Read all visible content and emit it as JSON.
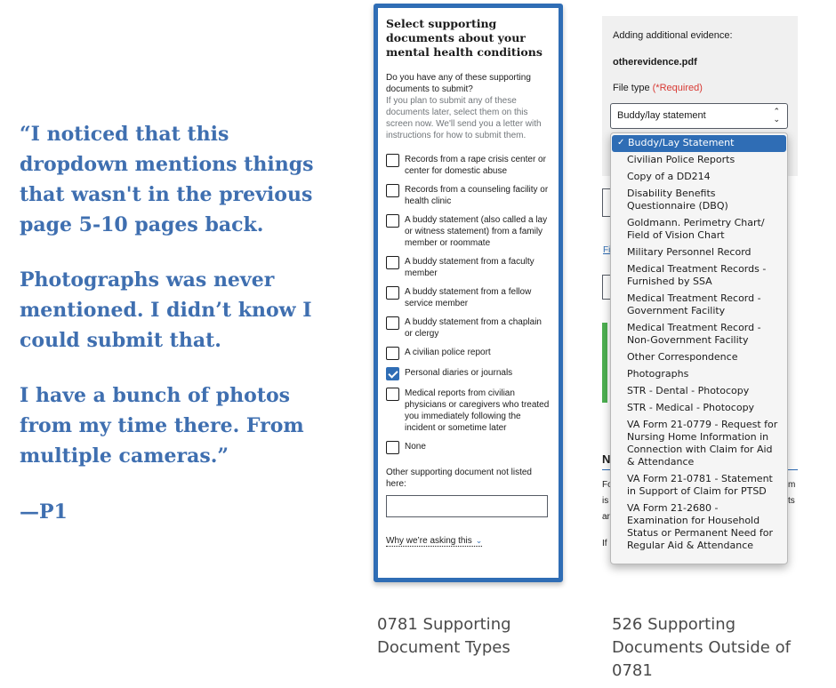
{
  "quote": {
    "paragraphs": [
      "“I noticed that this dropdown mentions things that wasn't in the previous page 5-10 pages back.",
      "Photographs was never mentioned. I didn’t know I could submit that.",
      "I have a bunch of photos from my time there. From multiple cameras.”"
    ],
    "attribution": "—P1"
  },
  "form_0781": {
    "title": "Select supporting documents about your mental health conditions",
    "question": "Do you have any of these supporting documents to submit?",
    "hint": "If you plan to submit any of these documents later, select them on this screen now. We'll send you a letter with instructions for how to submit them.",
    "options": [
      {
        "label": "Records from a rape crisis center or center for domestic abuse",
        "checked": false
      },
      {
        "label": "Records from a counseling facility or health clinic",
        "checked": false
      },
      {
        "label": "A buddy statement (also called a lay or witness statement) from a family member or roommate",
        "checked": false
      },
      {
        "label": "A buddy statement from a faculty member",
        "checked": false
      },
      {
        "label": "A buddy statement from a fellow service member",
        "checked": false
      },
      {
        "label": "A buddy statement from a chaplain or clergy",
        "checked": false
      },
      {
        "label": "A civilian police report",
        "checked": false
      },
      {
        "label": "Personal diaries or journals",
        "checked": true
      },
      {
        "label": "Medical reports from civilian physicians or caregivers who treated you immediately following the incident or sometime later",
        "checked": false
      },
      {
        "label": "None",
        "checked": false
      }
    ],
    "other_label": "Other supporting document not listed here:",
    "other_value": "",
    "why_link": "Why we’re asking this"
  },
  "form_526": {
    "heading": "Adding additional evidence:",
    "filename": "otherevidence.pdf",
    "file_type_label": "File type",
    "required": "(*Required)",
    "select_value": "Buddy/lay statement",
    "fragments": {
      "link": "Fi",
      "section": "N",
      "line1": "Fo",
      "line2": "is",
      "line3": "ar",
      "line4": "If",
      "right1": "m",
      "right2": "ts"
    },
    "dropdown_options": [
      {
        "label": "Buddy/Lay Statement",
        "selected": true
      },
      {
        "label": "Civilian Police Reports",
        "selected": false
      },
      {
        "label": "Copy of a DD214",
        "selected": false
      },
      {
        "label": "Disability Benefits Questionnaire (DBQ)",
        "selected": false
      },
      {
        "label": "Goldmann. Perimetry Chart/ Field of Vision Chart",
        "selected": false
      },
      {
        "label": "Military Personnel Record",
        "selected": false
      },
      {
        "label": "Medical Treatment Records - Furnished by SSA",
        "selected": false
      },
      {
        "label": "Medical Treatment Record - Government Facility",
        "selected": false
      },
      {
        "label": "Medical Treatment Record - Non-Government Facility",
        "selected": false
      },
      {
        "label": "Other Correspondence",
        "selected": false
      },
      {
        "label": "Photographs",
        "selected": false
      },
      {
        "label": "STR - Dental - Photocopy",
        "selected": false
      },
      {
        "label": "STR - Medical - Photocopy",
        "selected": false
      },
      {
        "label": "VA Form 21-0779 - Request for Nursing Home Information in Connection with Claim for Aid & Attendance",
        "selected": false
      },
      {
        "label": "VA Form 21-0781 - Statement in Support of Claim for PTSD",
        "selected": false
      },
      {
        "label": "VA Form 21-2680 - Examination for Household Status or Permanent Need for Regular Aid & Attendance",
        "selected": false
      }
    ]
  },
  "captions": {
    "left": "0781 Supporting Document Types",
    "right": "526 Supporting Documents Outside of 0781"
  },
  "colors": {
    "quote": "#3f6fb0",
    "card_border": "#2f6db5",
    "required": "#d83933",
    "accent_green": "#4caf50"
  }
}
